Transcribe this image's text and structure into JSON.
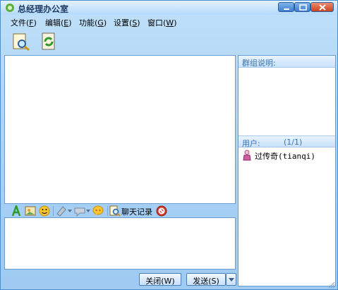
{
  "window": {
    "title": "总经理办公室"
  },
  "menu": [
    {
      "label": "文件(",
      "key": "F",
      "tail": ")"
    },
    {
      "label": "编辑(",
      "key": "E",
      "tail": ")"
    },
    {
      "label": "功能(",
      "key": "G",
      "tail": ")"
    },
    {
      "label": "设置(",
      "key": "S",
      "tail": ")"
    },
    {
      "label": "窗口(",
      "key": "W",
      "tail": ")"
    }
  ],
  "sidebar": {
    "group_header": "群组说明:",
    "users_header": "用户:",
    "users_count": "(1/1)",
    "users": [
      {
        "name": "过传奇(tianqi)"
      }
    ]
  },
  "format_toolbar": {
    "chat_history_label": "聊天记录"
  },
  "buttons": {
    "close_label": "关闭(W)",
    "send_label": "发送(S)"
  },
  "colors": {
    "accent": "#4a8fd0",
    "header_text": "#3b73b1",
    "close_btn": "#c84422"
  },
  "icons": [
    "search-document-icon",
    "refresh-document-icon",
    "font-icon",
    "image-icon",
    "emoji-icon",
    "screenshot-icon",
    "shake-icon",
    "bubble-icon",
    "chat-history-icon",
    "block-icon"
  ]
}
